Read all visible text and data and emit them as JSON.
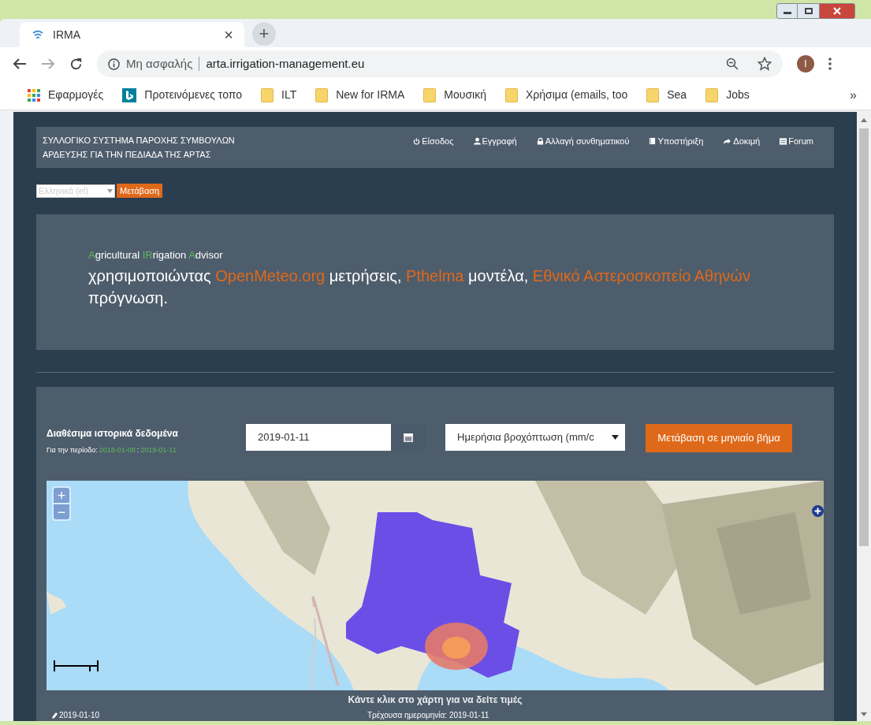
{
  "browser": {
    "tab": {
      "title": "IRMA",
      "close": "×"
    },
    "new_tab": "+",
    "address": {
      "security": "Μη ασφαλής",
      "url": "arta.irrigation-management.eu"
    },
    "profile_initial": "I",
    "bookmarks": [
      {
        "label": "Εφαρμογές",
        "kind": "apps"
      },
      {
        "label": "Προτεινόμενες τοπο",
        "kind": "bing"
      },
      {
        "label": "ILT",
        "kind": "folder"
      },
      {
        "label": "New for IRMA",
        "kind": "folder"
      },
      {
        "label": "Μουσική",
        "kind": "folder"
      },
      {
        "label": "Χρήσιμα (emails, too",
        "kind": "folder"
      },
      {
        "label": "Sea",
        "kind": "folder"
      },
      {
        "label": "Jobs",
        "kind": "folder"
      }
    ],
    "overflow": "»"
  },
  "header": {
    "title_lines": [
      "ΣΥΛΛΟΓΙΚΟ ΣΥΣΤΗΜΑ ΠΑΡΟΧΗΣ ΣΥΜΒΟΥΛΩΝ",
      "ΑΡΔΕΥΣΗΣ ΓΙΑ ΤΗΝ ΠΕΔΙΑΔΑ ΤΗΣ ΑΡΤΑΣ"
    ],
    "nav": [
      {
        "label": "Είσοδος",
        "kind": "power"
      },
      {
        "label": "Εγγραφή",
        "kind": "user"
      },
      {
        "label": "Αλλαγή συνθηματικού",
        "kind": "lock"
      },
      {
        "label": "Υποστήριξη",
        "kind": "book"
      },
      {
        "label": "Δοκιμή",
        "kind": "share"
      },
      {
        "label": "Forum",
        "kind": "list"
      }
    ]
  },
  "language": {
    "value": "Ελληνικά (el)",
    "button": "Μετάβαση"
  },
  "hero": {
    "tagline": [
      {
        "text": "A",
        "accent": true
      },
      {
        "text": "gricultural ",
        "accent": false
      },
      {
        "text": "IR",
        "accent": true
      },
      {
        "text": "rigation ",
        "accent": false
      },
      {
        "text": "A",
        "accent": true
      },
      {
        "text": "dvisor",
        "accent": false
      }
    ],
    "sentence": [
      {
        "text": "χρησιμοποιώντας ",
        "link": false
      },
      {
        "text": "OpenMeteo.org",
        "link": true
      },
      {
        "text": " μετρήσεις, ",
        "link": false
      },
      {
        "text": "Pthelma",
        "link": true
      },
      {
        "text": " μοντέλα, ",
        "link": false
      },
      {
        "text": "Εθνικό Αστεροσκοπείο Αθηνών",
        "link": true
      },
      {
        "text": " πρόγνωση.",
        "link": false
      }
    ]
  },
  "data_panel": {
    "title": "Διαθέσιμα ιστορικά δεδομένα",
    "period": {
      "label": "Για την περίοδο:",
      "from": "2018-01-08",
      "separator": ":",
      "to": "2019-01-11"
    },
    "date_value": "2019-01-11",
    "variable": "Ημερήσια βροχόπτωση (mm/c",
    "button": "Μετάβαση σε μηνιαίο βήμα",
    "map": {
      "kind": "picture",
      "zoom_in": "+",
      "zoom_out": "−"
    },
    "caption": "Κάντε κλικ στο χάρτη για να δείτε τιμές",
    "previous_date": "2019-01-10",
    "current_date": "Τρέχουσα ημερομηνία: 2019-01-11"
  }
}
